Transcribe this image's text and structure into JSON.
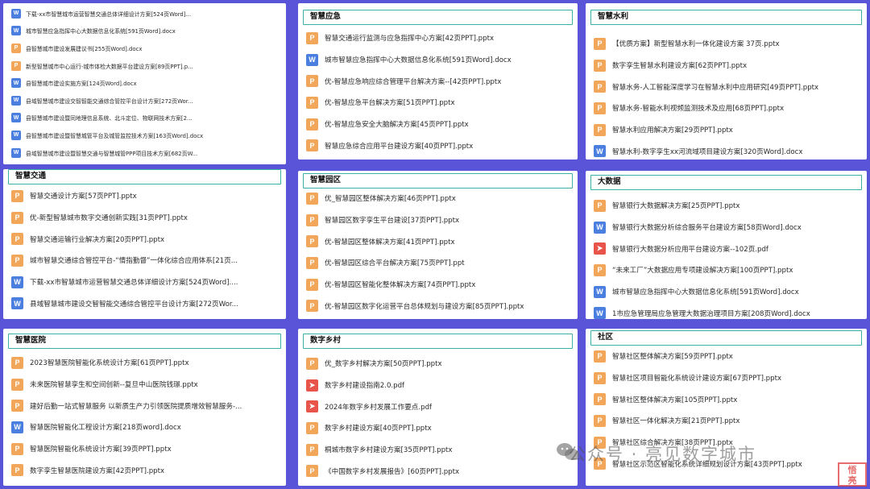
{
  "panels": [
    {
      "id": "p0",
      "title": "",
      "items": [
        {
          "type": "w",
          "label": "下载-xx市智慧城市运营智慧交通总体详细设计方案[524页Word]..."
        },
        {
          "type": "w",
          "label": "城市智慧应急指挥中心大数据信息化系统[591页Word].docx"
        },
        {
          "type": "p",
          "label": "县智慧城市建设发展建议书[255页Word].docx"
        },
        {
          "type": "p",
          "label": "新型智慧城市中心运行-城市体检大数据平台建设方案[89页PPT].p..."
        },
        {
          "type": "w",
          "label": "县智慧城市建设实施方案[124页Word].docx"
        },
        {
          "type": "w",
          "label": "县域智慧城市建设交智智能交通综合管控平台设计方案[272页Wor..."
        },
        {
          "type": "w",
          "label": "县智慧城市建设暨同地理信息系统、北斗定位、物联网技术方案[2..."
        },
        {
          "type": "w",
          "label": "县智慧城市建设暨智慧城管平台及城管监控技术方案[163页Word].docx"
        },
        {
          "type": "w",
          "label": "县域智慧城市建设暨智慧交通与智慧城管PPP项目技术方案[682页W..."
        }
      ]
    },
    {
      "id": "p1",
      "title": "智慧应急",
      "items": [
        {
          "type": "p",
          "label": "智慧交通运行监测与应急指挥中心方案[42页PPT].pptx"
        },
        {
          "type": "w",
          "label": "城市智慧应急指挥中心大数据信息化系统[591页Word].docx"
        },
        {
          "type": "p",
          "label": "优-智慧应急响应综合管理平台解决方案--[42页PPT].pptx"
        },
        {
          "type": "p",
          "label": "优-智慧应急平台解决方案[51页PPT].pptx"
        },
        {
          "type": "p",
          "label": "优-智慧应急安全大脑解决方案[45页PPT].pptx"
        },
        {
          "type": "p",
          "label": "智慧应急综合应用平台建设方案[40页PPT].pptx"
        }
      ]
    },
    {
      "id": "p2",
      "title": "智慧水利",
      "items": [
        {
          "type": "p",
          "label": "【优质方案】新型智慧水利一体化建设方案 37页.pptx"
        },
        {
          "type": "p",
          "label": "数字孪生智慧水利建设方案[62页PPT].pptx"
        },
        {
          "type": "p",
          "label": "智慧水务-人工智能深度学习在智慧水利中应用研究[49页PPT].pptx"
        },
        {
          "type": "p",
          "label": "智慧水务-智能水利视频监测技术及应用[68页PPT].pptx"
        },
        {
          "type": "p",
          "label": "智慧水利应用解决方案[29页PPT].pptx"
        },
        {
          "type": "w",
          "label": "智慧水利-数字孪生xx河流域项目建设方案[320页Word].docx"
        }
      ]
    },
    {
      "id": "p3",
      "title": "智慧交通",
      "items": [
        {
          "type": "p",
          "label": "智慧交通设计方案[57页PPT].pptx"
        },
        {
          "type": "p",
          "label": "优-新型智慧城市数字交通创新实践[31页PPT].pptx"
        },
        {
          "type": "p",
          "label": "智慧交通运输行业解决方案[20页PPT].pptx"
        },
        {
          "type": "p",
          "label": "城市智慧交通综合管控平台-“情指勤督”一体化综合应用体系[21页..."
        },
        {
          "type": "w",
          "label": "下载-xx市智慧城市运营智慧交通总体详细设计方案[524页Word]...."
        },
        {
          "type": "w",
          "label": "县域智慧城市建设交智智能交通综合管控平台设计方案[272页Wor..."
        }
      ]
    },
    {
      "id": "p4",
      "title": "智慧园区",
      "items": [
        {
          "type": "p",
          "label": "优_智慧园区整体解决方案[46页PPT].pptx"
        },
        {
          "type": "p",
          "label": "智慧园区数字孪生平台建设[37页PPT].pptx"
        },
        {
          "type": "p",
          "label": "优-智慧园区整体解决方案[41页PPT].pptx"
        },
        {
          "type": "p",
          "label": "优-智慧园区综合平台解决方案[75页PPT].ppt"
        },
        {
          "type": "p",
          "label": "优-智慧园区智能化整体解决方案[74页PPT].pptx"
        },
        {
          "type": "p",
          "label": "优-智慧园区数字化运营平台总体规划与建设方案[85页PPT].pptx"
        }
      ]
    },
    {
      "id": "p5",
      "title": "大数据",
      "items": [
        {
          "type": "p",
          "label": "智慧银行大数据解决方案[25页PPT].pptx"
        },
        {
          "type": "w",
          "label": "智慧银行大数据分析综合服务平台建设方案[58页Word].docx"
        },
        {
          "type": "d",
          "label": "智慧银行大数据分析应用平台建设方案--102页.pdf"
        },
        {
          "type": "p",
          "label": "“未来工厂”大数据应用专项建设解决方案[100页PPT].pptx"
        },
        {
          "type": "w",
          "label": "城市智慧应急指挥中心大数据信息化系统[591页Word].docx"
        },
        {
          "type": "w",
          "label": "1市应急管理局应急管理大数据治理项目方案[208页Word].docx"
        }
      ]
    },
    {
      "id": "p6",
      "title": "智慧医院",
      "items": [
        {
          "type": "p",
          "label": "2023智慧医院智能化系统设计方案[61页PPT].pptx"
        },
        {
          "type": "p",
          "label": "未来医院智慧孪生和空间创新--复旦中山医院钱璟.pptx"
        },
        {
          "type": "p",
          "label": "建好后勤一站式智慧服务 以新质生产力引领医院提质增效智慧服务-..."
        },
        {
          "type": "w",
          "label": "智慧医院智能化工程设计方案[218页word].docx"
        },
        {
          "type": "p",
          "label": "智慧医院智能化系统设计方案[39页PPT].pptx"
        },
        {
          "type": "p",
          "label": "数字孪生智慧医院建设方案[42页PPT].pptx"
        }
      ]
    },
    {
      "id": "p7",
      "title": "数字乡村",
      "items": [
        {
          "type": "p",
          "label": "优_数字乡村解决方案[50页PPT].pptx"
        },
        {
          "type": "d",
          "label": "数字乡村建设指南2.0.pdf"
        },
        {
          "type": "d",
          "label": "2024年数字乡村发展工作要点.pdf"
        },
        {
          "type": "p",
          "label": "数字乡村建设方案[40页PPT].pptx"
        },
        {
          "type": "p",
          "label": "桐城市数字乡村建设方案[35页PPT].pptx"
        },
        {
          "type": "p",
          "label": "《中国数字乡村发展报告》[60页PPT].pptx"
        }
      ]
    },
    {
      "id": "p8",
      "title": "社区",
      "items": [
        {
          "type": "p",
          "label": "智慧社区整体解决方案[59页PPT].pptx"
        },
        {
          "type": "p",
          "label": "智慧社区项目智能化系统设计建设方案[67页PPT].pptx"
        },
        {
          "type": "p",
          "label": "智慧社区整体解决方案[105页PPT].pptx"
        },
        {
          "type": "p",
          "label": "智慧社区一体化解决方案[21页PPT].pptx"
        },
        {
          "type": "p",
          "label": "智慧社区综合解决方案[38页PPT].pptx"
        },
        {
          "type": "p",
          "label": "智慧社区示范区智能化系统详细规划设计方案[43页PPT].pptx"
        }
      ]
    }
  ],
  "icon_glyphs": {
    "p": "P",
    "w": "W",
    "d": "➤"
  },
  "watermark": "公众号 · 亮见数字城市",
  "stamp": "悟\n亮"
}
